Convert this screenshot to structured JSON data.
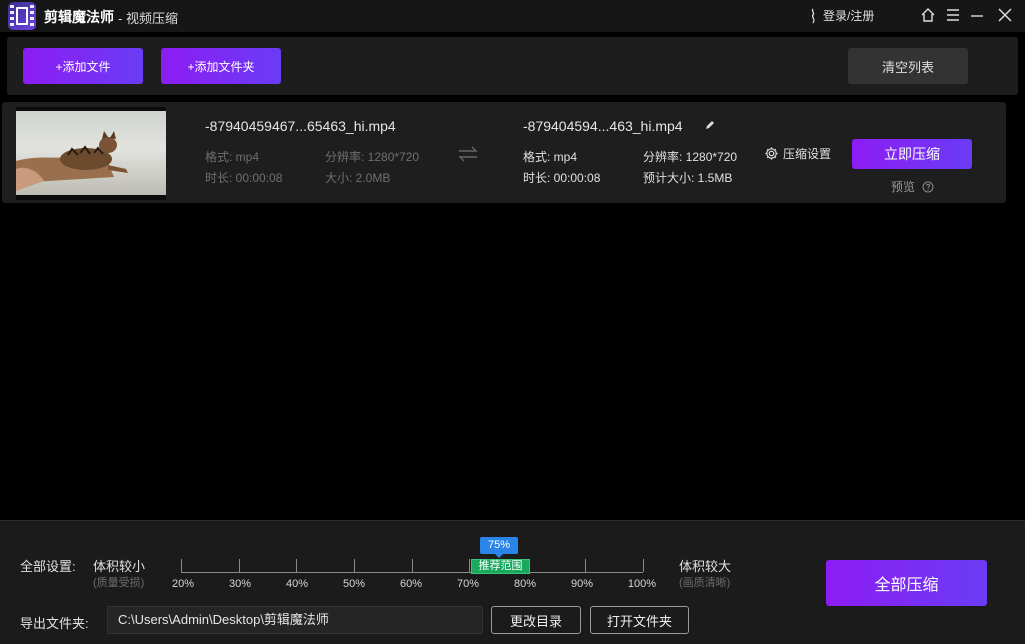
{
  "titlebar": {
    "app_name": "剪辑魔法师",
    "subtitle": "- 视频压缩",
    "login_label": "登录/注册"
  },
  "toolbar": {
    "add_file_label": "+添加文件",
    "add_folder_label": "+添加文件夹",
    "clear_list_label": "清空列表"
  },
  "file": {
    "source": {
      "name": "-87940459467...65463_hi.mp4",
      "format": "格式: mp4",
      "resolution": "分辨率: 1280*720",
      "duration": "时长: 00:00:08",
      "size": "大小: 2.0MB"
    },
    "output": {
      "name": "-879404594...463_hi.mp4",
      "format": "格式: mp4",
      "resolution": "分辨率: 1280*720",
      "duration": "时长: 00:00:08",
      "est_size": "预计大小: 1.5MB"
    },
    "settings_label": "压缩设置",
    "compress_now_label": "立即压缩",
    "preview_label": "预览"
  },
  "bottom": {
    "all_settings_label": "全部设置:",
    "smaller_label": "体积较小",
    "smaller_hint": "(质量受损)",
    "larger_label": "体积较大",
    "larger_hint": "(画质清晰)",
    "ticks": [
      "20%",
      "30%",
      "40%",
      "50%",
      "60%",
      "70%",
      "80%",
      "90%",
      "100%"
    ],
    "value_bubble": "75%",
    "value": 75,
    "recommended_label": "推荐范围",
    "export_folder_label": "导出文件夹:",
    "export_path": "C:\\Users\\Admin\\Desktop\\剪辑魔法师",
    "change_dir_label": "更改目录",
    "open_folder_label": "打开文件夹",
    "compress_all_label": "全部压缩"
  },
  "colors": {
    "accent_purple": "#8d1cf4",
    "accent_violet": "#6a3cf5",
    "recommended_green": "#1aa85c",
    "bubble_blue": "#2b84e8"
  }
}
